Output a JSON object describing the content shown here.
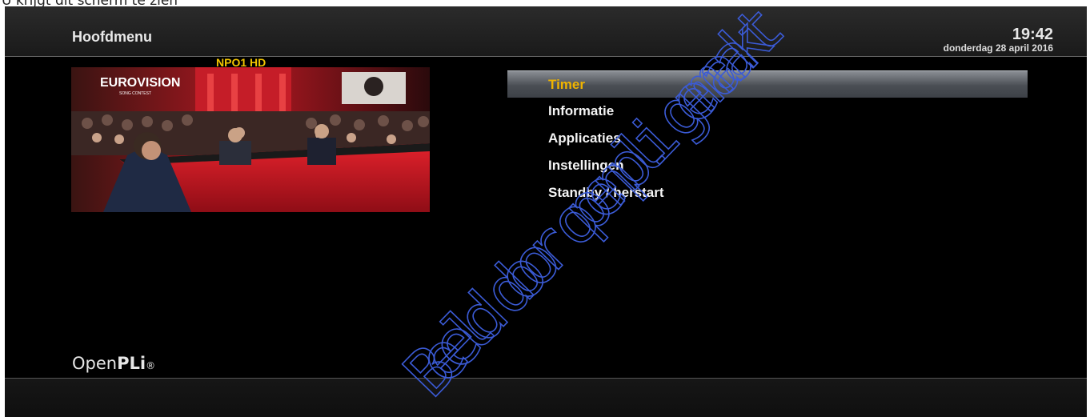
{
  "caption": "U krijgt dit scherm te zien",
  "header": {
    "title": "Hoofdmenu",
    "time": "19:42",
    "date": "donderdag 28 april 2016"
  },
  "preview": {
    "channel": "NPO1 HD",
    "show_logo": "EUROVISION",
    "show_subtitle": "SONG CONTEST"
  },
  "menu": {
    "items": [
      {
        "label": "Timer",
        "selected": true
      },
      {
        "label": "Informatie"
      },
      {
        "label": "Applicaties"
      },
      {
        "label": "Instellingen"
      },
      {
        "label": "Standby / herstart"
      }
    ]
  },
  "footer": {
    "logo_open": "Open",
    "logo_pli": "PLi",
    "logo_mark": "®"
  },
  "watermark": "Beeld door openpli gemaakt",
  "colors": {
    "selected_text": "#f0b400",
    "channel_text": "#f2c400",
    "background": "#000000",
    "watermark": "#3b5bd6"
  }
}
